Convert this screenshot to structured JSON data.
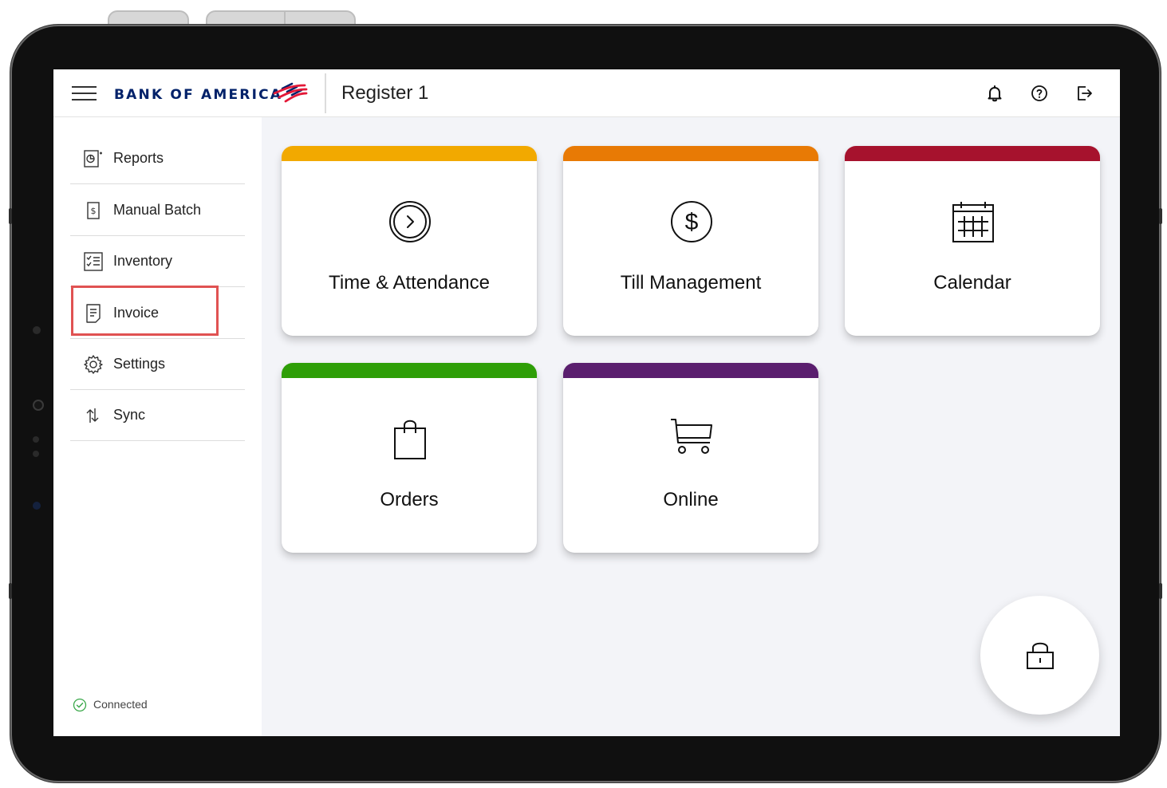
{
  "app": {
    "brand_name": "BANK OF AMERICA",
    "register_title": "Register 1"
  },
  "topbar": {
    "icons": [
      "menu-icon",
      "bell-icon",
      "help-icon",
      "logout-icon"
    ]
  },
  "sidebar": {
    "items": [
      {
        "label": "Reports",
        "icon": "reports-icon"
      },
      {
        "label": "Manual Batch",
        "icon": "manual-batch-icon"
      },
      {
        "label": "Inventory",
        "icon": "inventory-icon"
      },
      {
        "label": "Invoice",
        "icon": "invoice-icon",
        "highlighted": true
      },
      {
        "label": "Settings",
        "icon": "gear-icon"
      },
      {
        "label": "Sync",
        "icon": "sync-icon"
      }
    ],
    "status_text": "Connected"
  },
  "tiles": [
    {
      "label": "Time & Attendance",
      "icon": "clock-icon",
      "color": "#f2a900"
    },
    {
      "label": "Till Management",
      "icon": "dollar-icon",
      "color": "#e87a05"
    },
    {
      "label": "Calendar",
      "icon": "calendar-icon",
      "color": "#a6122d"
    },
    {
      "label": "Orders",
      "icon": "shopping-bag-icon",
      "color": "#2e9e07"
    },
    {
      "label": "Online",
      "icon": "cart-icon",
      "color": "#5a1e6e"
    }
  ],
  "colors": {
    "brand_blue": "#012169",
    "brand_red": "#e31837",
    "highlight": "#e05252",
    "connected_green": "#3aa84a"
  },
  "lock_button_icon": "lock-icon"
}
